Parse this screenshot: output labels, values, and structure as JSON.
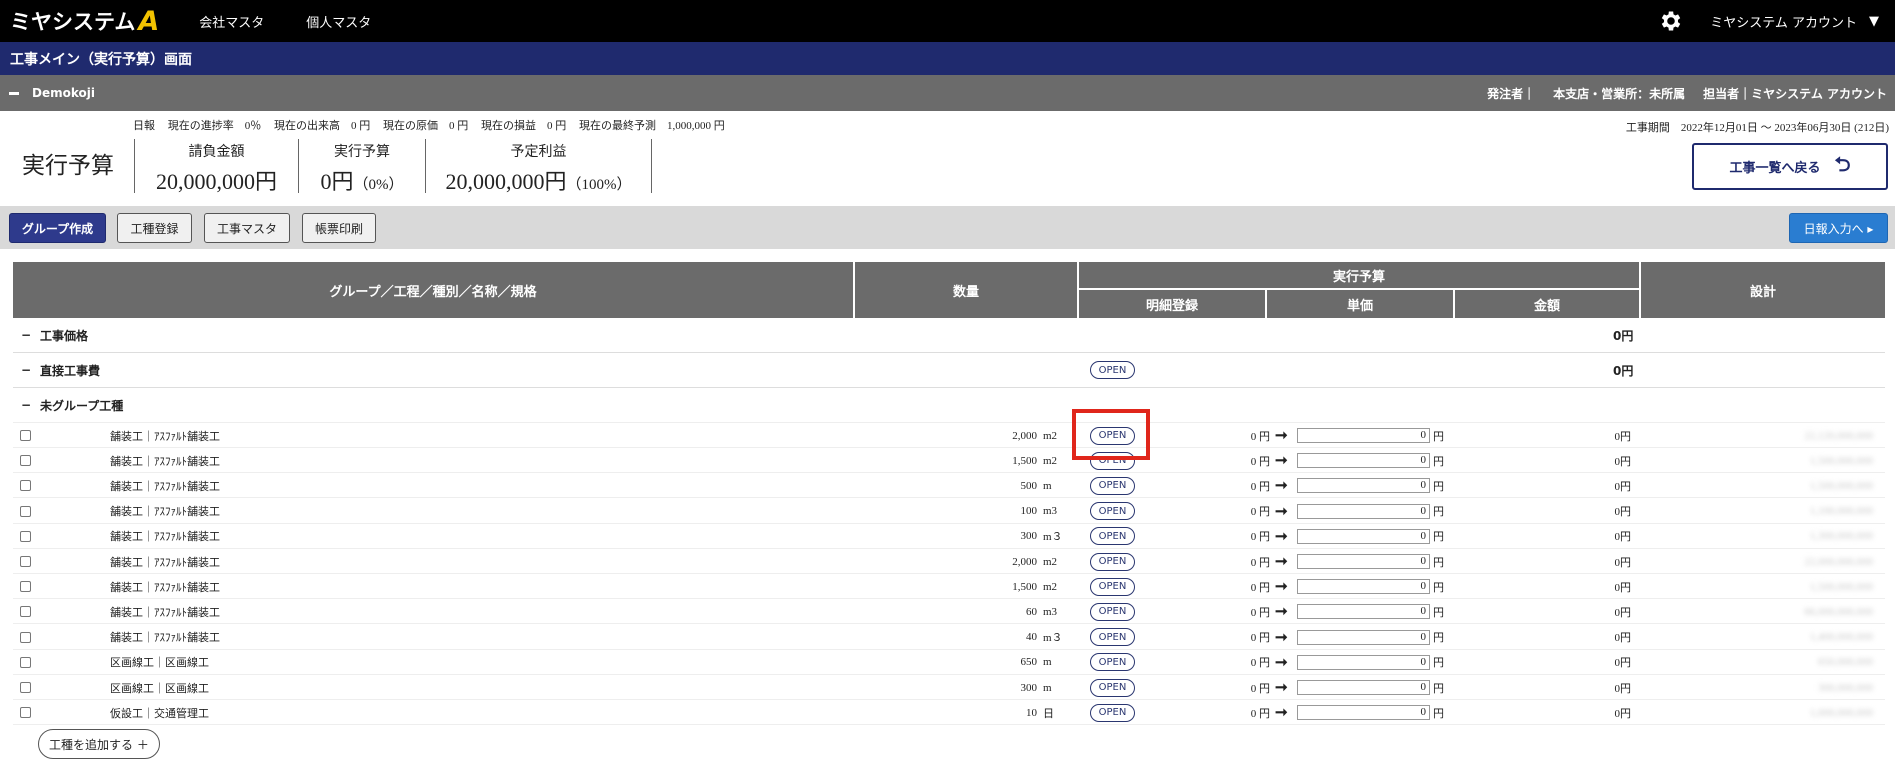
{
  "topnav": {
    "logo_text": "ミヤシステム",
    "logo_mark": "A",
    "links": [
      "会社マスタ",
      "個人マスタ"
    ],
    "account": "ミヤシステム アカウント"
  },
  "titlebar": {
    "title": "工事メイン（実行予算）画面"
  },
  "project": {
    "name": "Demokoji",
    "client": "発注者｜",
    "branch": "本支店・営業所：未所属",
    "manager": "担当者｜ミヤシステム アカウント"
  },
  "status": {
    "daily": "日報",
    "progress": "現在の進捗率　0％",
    "output": "現在の出来高　0 円",
    "cost": "現在の原価　0 円",
    "profit_loss": "現在の損益　0 円",
    "final_forecast": "現在の最終予測　1,000,000 円",
    "period": "工事期間　2022年12月01日 ～ 2023年06月30日 (212日)"
  },
  "summary": {
    "page_label": "実行予算",
    "contract_label": "請負金額",
    "contract_value": "20,000,000円",
    "budget_label": "実行予算",
    "budget_value": "0円",
    "budget_pct": "（0%）",
    "profit_label": "予定利益",
    "profit_value": "20,000,000円",
    "profit_pct": "（100%）",
    "back_label": "工事一覧へ戻る"
  },
  "toolbar": {
    "create_group": "グループ作成",
    "register_type": "工種登録",
    "type_master": "工事マスタ",
    "print": "帳票印刷",
    "daily_input": "日報入力へ ▸"
  },
  "table": {
    "headers": {
      "group": "グループ／工程／種別／名称／規格",
      "quantity": "数量",
      "budget": "実行予算",
      "detail": "明細登録",
      "unit_price": "単価",
      "amount": "金額",
      "design": "設計"
    },
    "groups": [
      {
        "name": "工事価格",
        "amount": "0円",
        "open": ""
      },
      {
        "name": "直接工事費",
        "amount": "0円",
        "open": "OPEN"
      },
      {
        "name": "未グループ工種",
        "amount": "",
        "open": ""
      }
    ],
    "open_label": "OPEN",
    "yen": "円",
    "items": [
      {
        "name": "舗装工｜ｱｽﾌｧﾙﾄ舗装工",
        "qty": "2,000",
        "unit": "m2",
        "price": "0 円",
        "input": "0",
        "amount": "0円",
        "design": "22,120,000,000"
      },
      {
        "name": "舗装工｜ｱｽﾌｧﾙﾄ舗装工",
        "qty": "1,500",
        "unit": "m2",
        "price": "0 円",
        "input": "0",
        "amount": "0円",
        "design": "1,500,000,000"
      },
      {
        "name": "舗装工｜ｱｽﾌｧﾙﾄ舗装工",
        "qty": "500",
        "unit": "m",
        "price": "0 円",
        "input": "0",
        "amount": "0円",
        "design": "1,500,000,000"
      },
      {
        "name": "舗装工｜ｱｽﾌｧﾙﾄ舗装工",
        "qty": "100",
        "unit": "m3",
        "price": "0 円",
        "input": "0",
        "amount": "0円",
        "design": "1,100,000,000"
      },
      {
        "name": "舗装工｜ｱｽﾌｧﾙﾄ舗装工",
        "qty": "300",
        "unit": "m３",
        "price": "0 円",
        "input": "0",
        "amount": "0円",
        "design": "1,300,000,000"
      },
      {
        "name": "舗装工｜ｱｽﾌｧﾙﾄ舗装工",
        "qty": "2,000",
        "unit": "m2",
        "price": "0 円",
        "input": "0",
        "amount": "0円",
        "design": "22,000,000,000"
      },
      {
        "name": "舗装工｜ｱｽﾌｧﾙﾄ舗装工",
        "qty": "1,500",
        "unit": "m2",
        "price": "0 円",
        "input": "0",
        "amount": "0円",
        "design": "1,500,000,000"
      },
      {
        "name": "舗装工｜ｱｽﾌｧﾙﾄ舗装工",
        "qty": "60",
        "unit": "m3",
        "price": "0 円",
        "input": "0",
        "amount": "0円",
        "design": "66,000,000,000"
      },
      {
        "name": "舗装工｜ｱｽﾌｧﾙﾄ舗装工",
        "qty": "40",
        "unit": "m３",
        "price": "0 円",
        "input": "0",
        "amount": "0円",
        "design": "1,400,000,000"
      },
      {
        "name": "区画線工｜区画線工",
        "qty": "650",
        "unit": "m",
        "price": "0 円",
        "input": "0",
        "amount": "0円",
        "design": "650,000,000"
      },
      {
        "name": "区画線工｜区画線工",
        "qty": "300",
        "unit": "m",
        "price": "0 円",
        "input": "0",
        "amount": "0円",
        "design": "300,000,000"
      },
      {
        "name": "仮設工｜交通管理工",
        "qty": "10",
        "unit": "日",
        "price": "0 円",
        "input": "0",
        "amount": "0円",
        "design": "1,000,000,000"
      }
    ],
    "add_label": "工種を追加する ＋"
  }
}
